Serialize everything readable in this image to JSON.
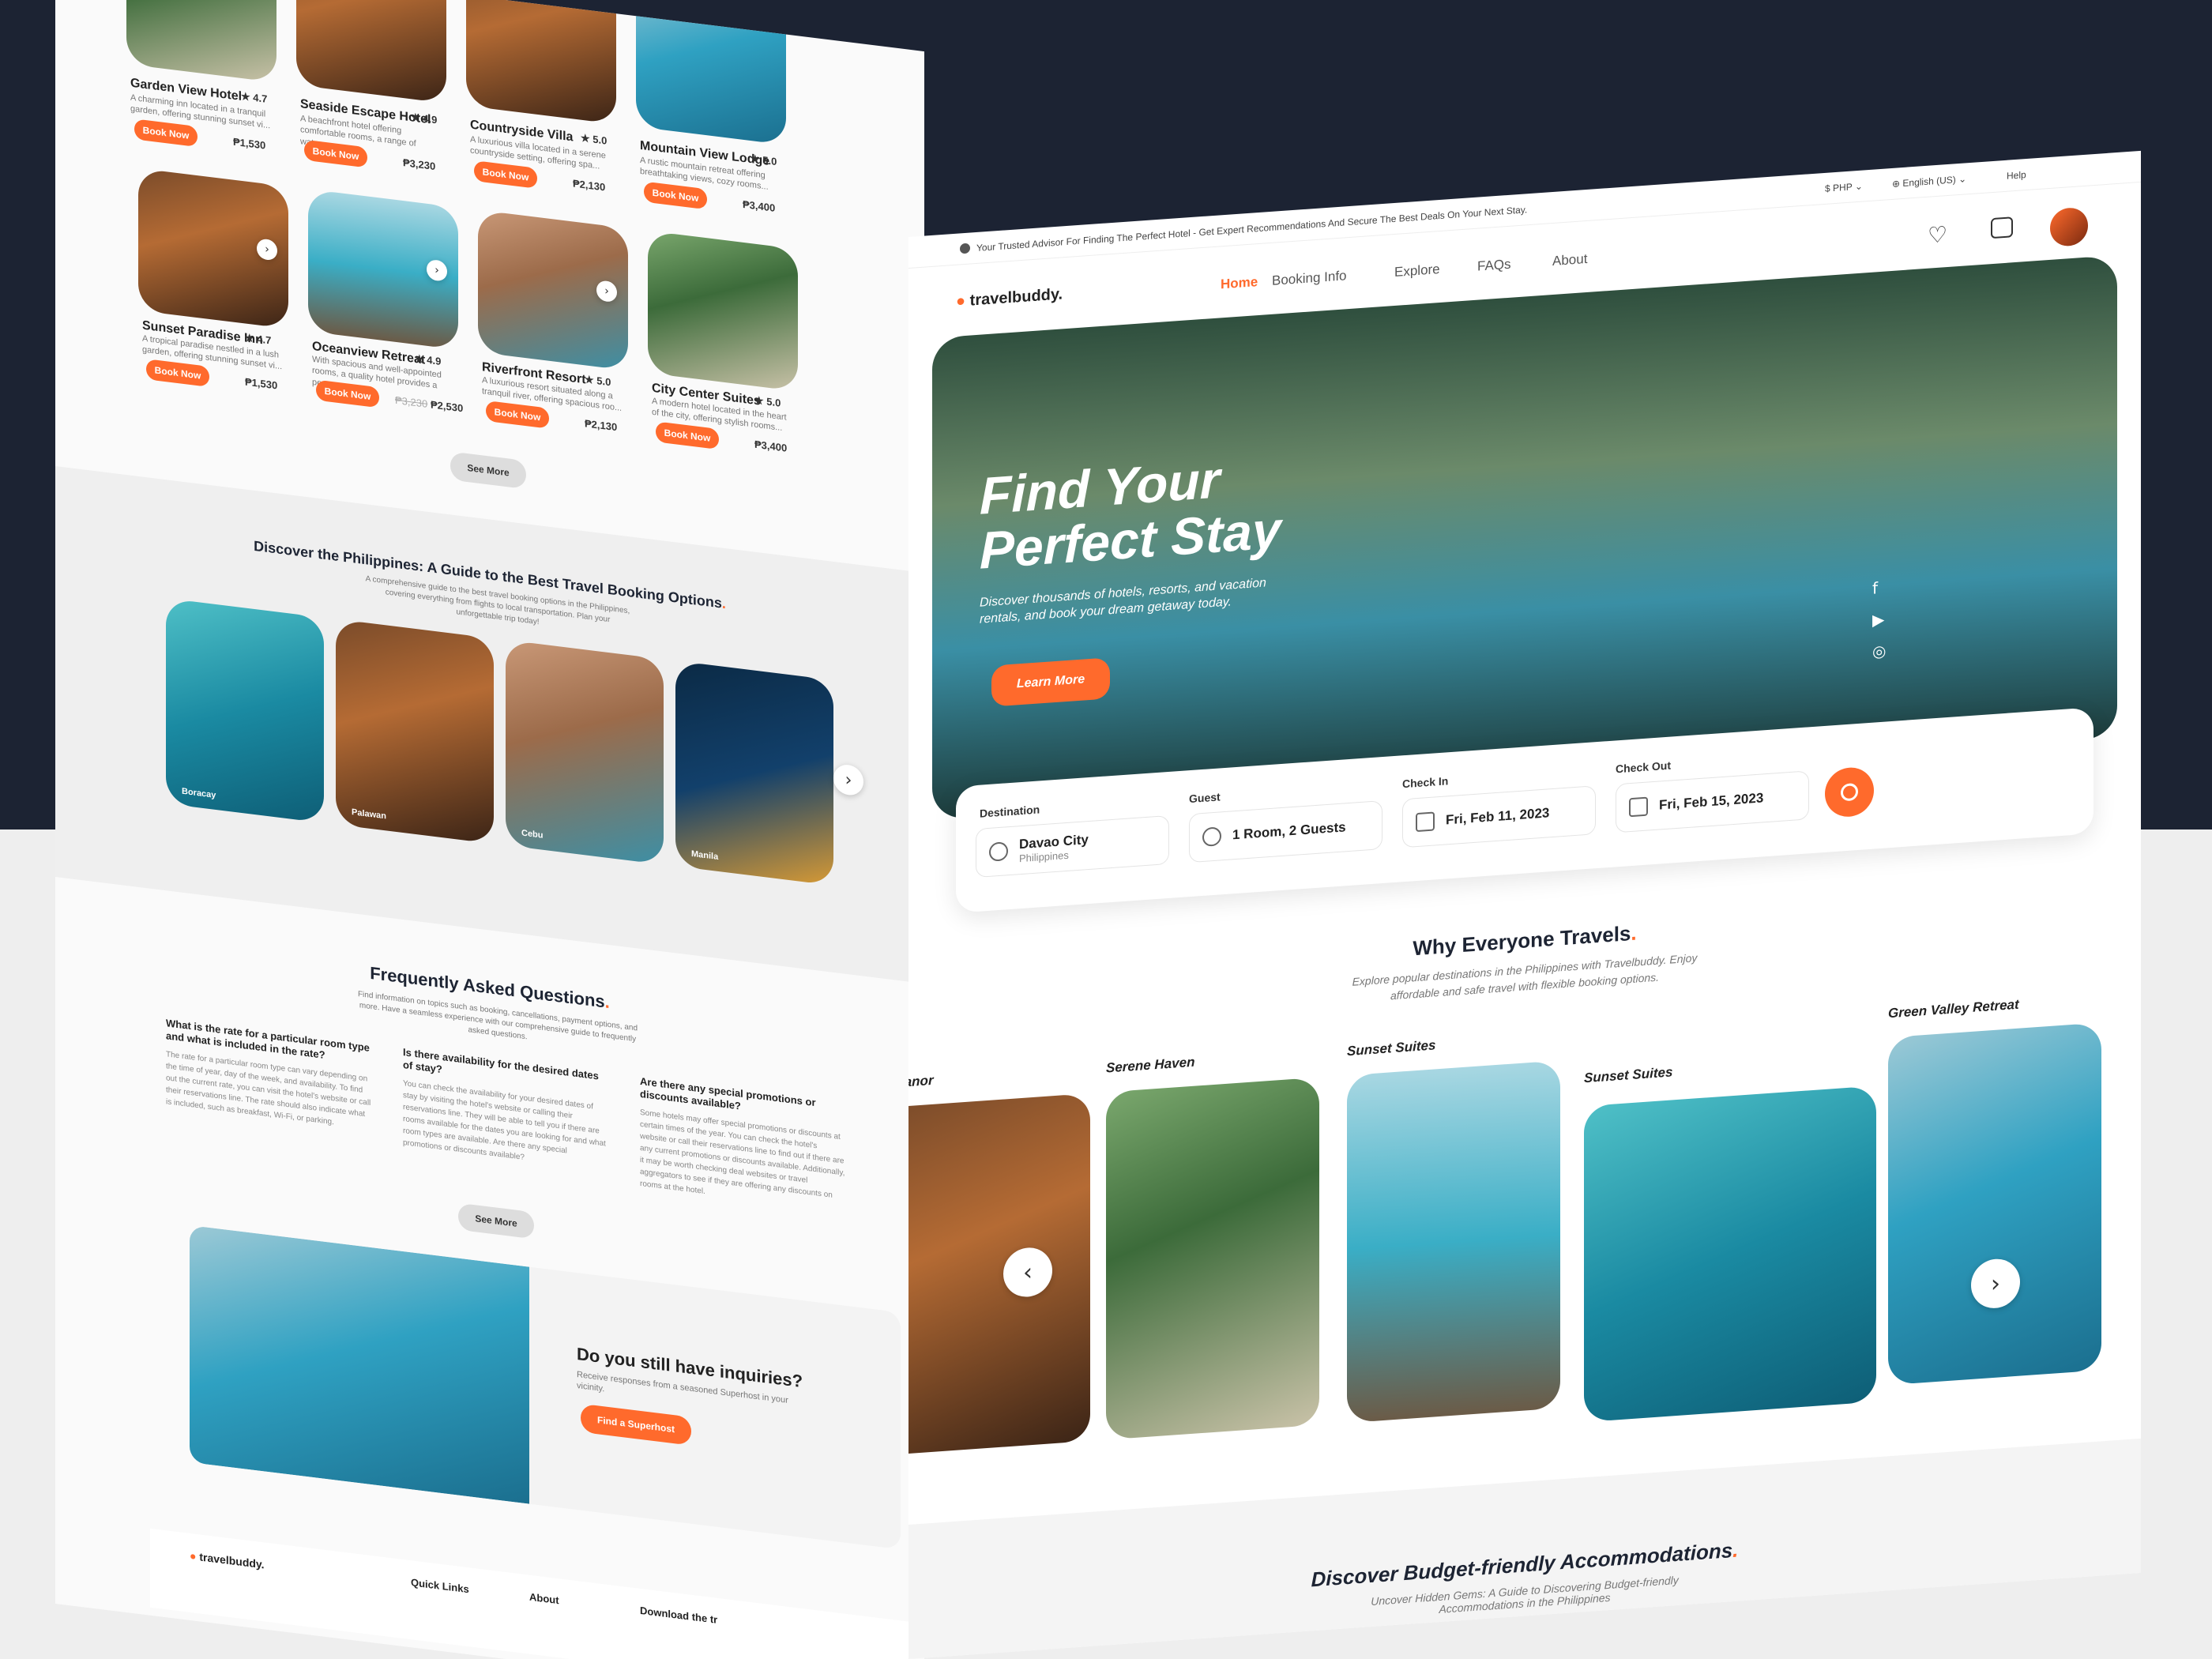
{
  "left": {
    "hotels_row1": [
      {
        "name": "Garden View Hotel",
        "rating": "4.7",
        "desc": "A charming inn located in a tranquil garden, offering stunning sunset vi...",
        "price": "₱1,530",
        "cta": "Book Now"
      },
      {
        "name": "Seaside Escape Hotel",
        "rating": "4.9",
        "desc": "A beachfront hotel offering comfortable rooms, a range of water...",
        "price": "₱3,230",
        "cta": "Book Now"
      },
      {
        "name": "Countryside Villa",
        "rating": "5.0",
        "desc": "A luxurious villa located in a serene countryside setting, offering spa...",
        "price": "₱2,130",
        "cta": "Book Now"
      },
      {
        "name": "Mountain View Lodge",
        "rating": "5.0",
        "desc": "A rustic mountain retreat offering breathtaking views, cozy rooms...",
        "price": "₱3,400",
        "cta": "Book Now"
      }
    ],
    "hotels_row2": [
      {
        "name": "Sunset Paradise Inn",
        "rating": "4.7",
        "desc": "A tropical paradise nestled in a lush garden, offering stunning sunset vi...",
        "price": "₱1,530",
        "old_price": "",
        "cta": "Book Now"
      },
      {
        "name": "Oceanview Retreat",
        "rating": "4.9",
        "desc": "With spacious and well-appointed rooms, a quality hotel provides a pe...",
        "price": "₱2,530",
        "old_price": "₱3,230",
        "cta": "Book Now"
      },
      {
        "name": "Riverfront Resort",
        "rating": "5.0",
        "desc": "A luxurious resort situated along a tranquil river, offering spacious roo...",
        "price": "₱2,130",
        "old_price": "",
        "cta": "Book Now"
      },
      {
        "name": "City Center Suites",
        "rating": "5.0",
        "desc": "A modern hotel located in the heart of the city, offering stylish rooms...",
        "price": "₱3,400",
        "old_price": "",
        "cta": "Book Now"
      }
    ],
    "see_more": "See More",
    "guide": {
      "title": "Discover the Philippines: A Guide to the Best Travel Booking Options",
      "sub": "A comprehensive guide to the best travel booking options in the Philippines, covering everything from flights to local transportation. Plan your unforgettable trip today!",
      "places": [
        "Boracay",
        "Palawan",
        "Cebu",
        "Manila"
      ]
    },
    "faq": {
      "title": "Frequently Asked Questions",
      "sub": "Find information on topics such as booking, cancellations, payment options, and more. Have a seamless experience with our comprehensive guide to frequently asked questions.",
      "items": [
        {
          "q": "What is the rate for a particular room type and what is included in the rate?",
          "a": "The rate for a particular room type can vary depending on the time of year, day of the week, and availability. To find out the current rate, you can visit the hotel's website or call their reservations line. The rate should also indicate what is included, such as breakfast, Wi-Fi, or parking."
        },
        {
          "q": "Is there availability for the desired dates of stay?",
          "a": "You can check the availability for your desired dates of stay by visiting the hotel's website or calling their reservations line. They will be able to tell you if there are rooms available for the dates you are looking for and what room types are available. Are there any special promotions or discounts available?"
        },
        {
          "q": "Are there any special promotions or discounts available?",
          "a": "Some hotels may offer special promotions or discounts at certain times of the year. You can check the hotel's website or call their reservations line to find out if there are any current promotions or discounts available. Additionally, it may be worth checking deal websites or travel aggregators to see if they are offering any discounts on rooms at the hotel."
        }
      ],
      "see_more": "See More"
    },
    "inquiry": {
      "title": "Do you still have inquiries?",
      "sub": "Receive responses from a seasoned Superhost in your vicinity.",
      "cta": "Find a Superhost"
    },
    "footer": {
      "brand": "travelbuddy.",
      "cols": [
        "Quick Links",
        "About",
        "Download the tr"
      ]
    }
  },
  "right": {
    "topbar": {
      "notice": "Your Trusted Advisor For Finding The Perfect Hotel - Get Expert Recommendations And Secure The Best Deals On Your Next Stay.",
      "currency": "PHP",
      "language": "English (US)",
      "help": "Help"
    },
    "brand": "travelbuddy.",
    "nav": [
      "Home",
      "Booking Info",
      "Explore",
      "FAQs",
      "About"
    ],
    "hero": {
      "title_1": "Find Your",
      "title_2": "Perfect Stay",
      "sub": "Discover thousands of hotels, resorts, and vacation rentals, and book your dream getaway today.",
      "cta": "Learn More"
    },
    "search": {
      "destination_label": "Destination",
      "destination": "Davao City",
      "destination_sub": "Philippines",
      "guest_label": "Guest",
      "guest": "1 Room, 2 Guests",
      "checkin_label": "Check In",
      "checkin": "Fri, Feb 11, 2023",
      "checkout_label": "Check Out",
      "checkout": "Fri, Feb 15, 2023"
    },
    "why": {
      "title": "Why Everyone Travels",
      "sub": "Explore popular destinations in the Philippines with Travelbuddy. Enjoy affordable and safe travel with flexible booking options."
    },
    "destinations": [
      "lanor",
      "Serene Haven",
      "Sunset Suites",
      "Sunset Suites",
      "Green Valley Retreat"
    ],
    "budget": {
      "title": "Discover Budget-friendly Accommodations",
      "sub": "Uncover Hidden Gems: A Guide to Discovering Budget-friendly Accommodations in the Philippines"
    },
    "accent": "#ff6a2c"
  }
}
